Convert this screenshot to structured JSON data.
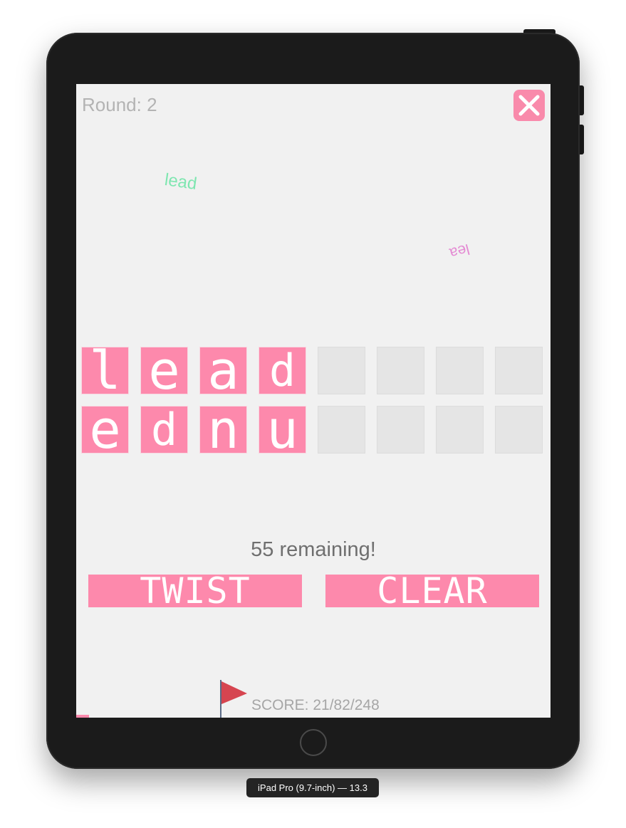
{
  "device": {
    "label": "iPad Pro (9.7-inch) — 13.3"
  },
  "game": {
    "round_label": "Round: 2",
    "close_icon": "close-x-icon",
    "floating_words": [
      "lead",
      "lea"
    ],
    "answer_tiles": [
      "l",
      "e",
      "a",
      "d",
      "",
      "",
      "",
      ""
    ],
    "letter_tiles": [
      "e",
      "d",
      "n",
      "u",
      "",
      "",
      "",
      ""
    ],
    "remaining_text": "55 remaining!",
    "twist_label": "TWIST",
    "clear_label": "CLEAR",
    "score_text": "SCORE: 21/82/248",
    "flag_icon": "flag-icon"
  },
  "colors": {
    "accent_pink": "#fd89ac",
    "float_green": "#7ee6b0",
    "float_magenta": "#e48ad3",
    "flag_red": "#d64550"
  }
}
